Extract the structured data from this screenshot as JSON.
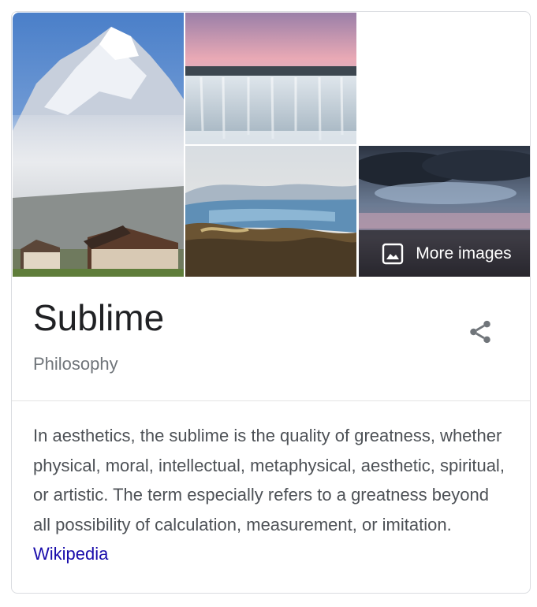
{
  "images": {
    "tiles": [
      {
        "name": "mountain-image",
        "icon": "mountain-photo"
      },
      {
        "name": "waterfall-image",
        "icon": "waterfall-photo"
      },
      {
        "name": "lake-painting-image",
        "icon": "lake-painting"
      },
      {
        "name": "storm-sky-image",
        "icon": "storm-sky-photo"
      }
    ],
    "more_images_label": "More images",
    "more_images_icon": "image-icon"
  },
  "entity": {
    "title": "Sublime",
    "subtitle": "Philosophy",
    "share_icon": "share-icon"
  },
  "description": {
    "text": "In aesthetics, the sublime is the quality of greatness, whether physical, moral, intellectual, metaphysical, aesthetic, spiritual, or artistic. The term especially refers to a greatness beyond all possibility of calculation, measurement, or imitation.",
    "source_link": "Wikipedia"
  },
  "colors": {
    "link": "#1a0dab",
    "title": "#202124",
    "subtitle": "#70757a",
    "body": "#4d5156",
    "border": "#dadce0"
  }
}
